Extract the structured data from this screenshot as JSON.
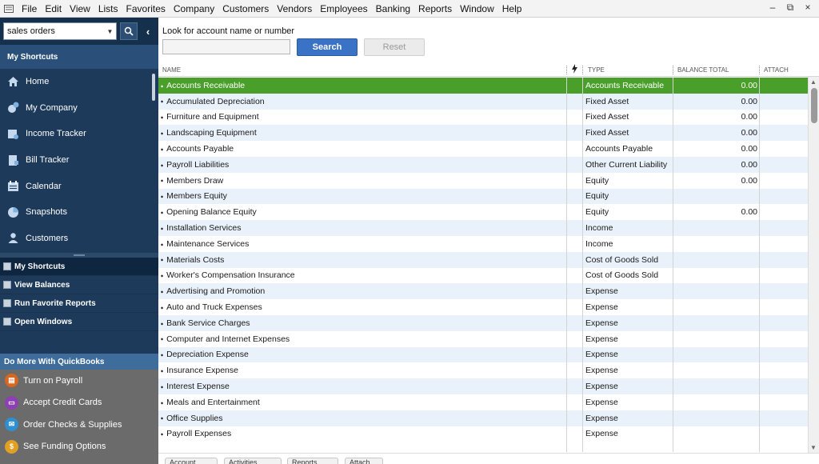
{
  "menu": [
    "File",
    "Edit",
    "View",
    "Lists",
    "Favorites",
    "Company",
    "Customers",
    "Vendors",
    "Employees",
    "Banking",
    "Reports",
    "Window",
    "Help"
  ],
  "window_controls": [
    "–",
    "⧉",
    "×"
  ],
  "left_panel": {
    "search_value": "sales orders",
    "shortcuts_header": "My Shortcuts",
    "nav": [
      {
        "label": "Home",
        "icon": "home-icon"
      },
      {
        "label": "My Company",
        "icon": "company-icon"
      },
      {
        "label": "Income Tracker",
        "icon": "income-tracker-icon"
      },
      {
        "label": "Bill Tracker",
        "icon": "bill-tracker-icon"
      },
      {
        "label": "Calendar",
        "icon": "calendar-icon"
      },
      {
        "label": "Snapshots",
        "icon": "pie-chart-icon"
      },
      {
        "label": "Customers",
        "icon": "person-icon"
      }
    ],
    "sub_nav": [
      {
        "label": "My Shortcuts",
        "active": true
      },
      {
        "label": "View Balances",
        "active": false
      },
      {
        "label": "Run Favorite Reports",
        "active": false
      },
      {
        "label": "Open Windows",
        "active": false
      }
    ],
    "do_more_header": "Do More With QuickBooks",
    "do_more": [
      {
        "label": "Turn on Payroll",
        "icon": "payroll-icon",
        "color": "#d9661f"
      },
      {
        "label": "Accept Credit Cards",
        "icon": "credit-card-icon",
        "color": "#8e3fb3"
      },
      {
        "label": "Order Checks & Supplies",
        "icon": "checks-icon",
        "color": "#2f8fd0"
      },
      {
        "label": "See Funding Options",
        "icon": "dollar-icon",
        "color": "#e0a021"
      }
    ]
  },
  "main": {
    "look_label": "Look for account name or number",
    "search_button": "Search",
    "reset_button": "Reset",
    "columns": {
      "name": "NAME",
      "type": "TYPE",
      "balance": "BALANCE TOTAL",
      "attach": "ATTACH"
    },
    "accounts": [
      {
        "name": "Accounts Receivable",
        "type": "Accounts Receivable",
        "balance": "0.00",
        "selected": true
      },
      {
        "name": "Accumulated Depreciation",
        "type": "Fixed Asset",
        "balance": "0.00"
      },
      {
        "name": "Furniture and Equipment",
        "type": "Fixed Asset",
        "balance": "0.00"
      },
      {
        "name": "Landscaping Equipment",
        "type": "Fixed Asset",
        "balance": "0.00"
      },
      {
        "name": "Accounts Payable",
        "type": "Accounts Payable",
        "balance": "0.00"
      },
      {
        "name": "Payroll Liabilities",
        "type": "Other Current Liability",
        "balance": "0.00"
      },
      {
        "name": "Members Draw",
        "type": "Equity",
        "balance": "0.00"
      },
      {
        "name": "Members Equity",
        "type": "Equity",
        "balance": ""
      },
      {
        "name": "Opening Balance Equity",
        "type": "Equity",
        "balance": "0.00"
      },
      {
        "name": "Installation Services",
        "type": "Income",
        "balance": ""
      },
      {
        "name": "Maintenance Services",
        "type": "Income",
        "balance": ""
      },
      {
        "name": "Materials Costs",
        "type": "Cost of Goods Sold",
        "balance": ""
      },
      {
        "name": "Worker's Compensation Insurance",
        "type": "Cost of Goods Sold",
        "balance": ""
      },
      {
        "name": "Advertising and Promotion",
        "type": "Expense",
        "balance": ""
      },
      {
        "name": "Auto and Truck Expenses",
        "type": "Expense",
        "balance": ""
      },
      {
        "name": "Bank Service Charges",
        "type": "Expense",
        "balance": ""
      },
      {
        "name": "Computer and Internet Expenses",
        "type": "Expense",
        "balance": ""
      },
      {
        "name": "Depreciation Expense",
        "type": "Expense",
        "balance": ""
      },
      {
        "name": "Insurance Expense",
        "type": "Expense",
        "balance": ""
      },
      {
        "name": "Interest Expense",
        "type": "Expense",
        "balance": ""
      },
      {
        "name": "Meals and Entertainment",
        "type": "Expense",
        "balance": ""
      },
      {
        "name": "Office Supplies",
        "type": "Expense",
        "balance": ""
      },
      {
        "name": "Payroll Expenses",
        "type": "Expense",
        "balance": ""
      }
    ],
    "bottom_buttons": [
      "Account",
      "Activities",
      "Reports",
      "Attach"
    ]
  },
  "colors": {
    "selected_row": "#4a9e2a",
    "search_button": "#3a72c6",
    "sidebar": "#1d3a5a"
  }
}
